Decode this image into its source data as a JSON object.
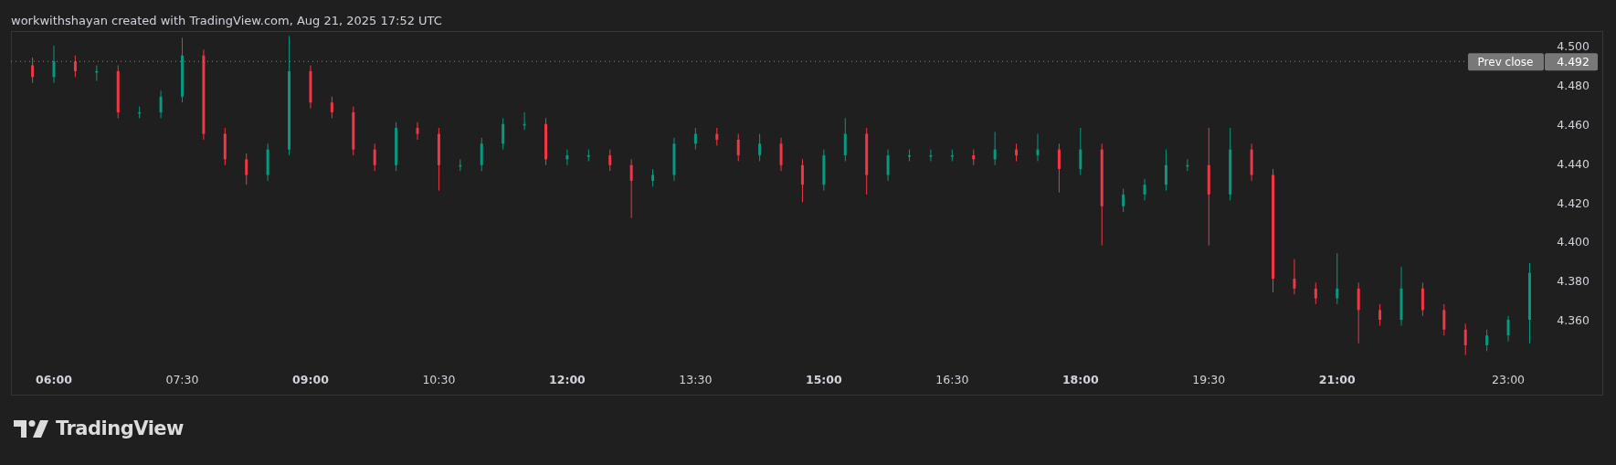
{
  "header": {
    "text": "workwithshayan created with TradingView.com, Aug 21, 2025 17:52 UTC"
  },
  "chart": {
    "chart_data": {
      "type": "candlestick",
      "x": [
        5.75,
        6,
        6.25,
        6.5,
        6.75,
        7,
        7.25,
        7.5,
        7.75,
        8,
        8.25,
        8.5,
        8.75,
        9,
        9.25,
        9.5,
        9.75,
        10,
        10.25,
        10.5,
        10.75,
        11,
        11.25,
        11.5,
        11.75,
        12,
        12.25,
        12.5,
        12.75,
        13,
        13.25,
        13.5,
        13.75,
        14,
        14.25,
        14.5,
        14.75,
        15,
        15.25,
        15.5,
        15.75,
        16,
        16.25,
        16.5,
        16.75,
        17,
        17.25,
        17.5,
        17.75,
        18,
        18.25,
        18.5,
        18.75,
        19,
        19.25,
        19.5,
        19.75,
        20,
        20.25,
        20.5,
        20.75,
        21,
        21.25,
        21.5,
        21.75,
        22,
        22.25,
        22.5,
        22.75,
        23,
        23.25
      ],
      "ohlc": [
        [
          4.49,
          4.494,
          4.481,
          4.484
        ],
        [
          4.484,
          4.5,
          4.481,
          4.492
        ],
        [
          4.492,
          4.495,
          4.484,
          4.487
        ],
        [
          4.487,
          4.49,
          4.482,
          4.487
        ],
        [
          4.487,
          4.49,
          4.463,
          4.466
        ],
        [
          4.466,
          4.469,
          4.463,
          4.466
        ],
        [
          4.466,
          4.477,
          4.463,
          4.474
        ],
        [
          4.474,
          4.504,
          4.471,
          4.495
        ],
        [
          4.495,
          4.498,
          4.452,
          4.455
        ],
        [
          4.455,
          4.458,
          4.439,
          4.442
        ],
        [
          4.442,
          4.445,
          4.429,
          4.434
        ],
        [
          4.434,
          4.45,
          4.431,
          4.447
        ],
        [
          4.447,
          4.505,
          4.444,
          4.487
        ],
        [
          4.487,
          4.49,
          4.468,
          4.471
        ],
        [
          4.471,
          4.474,
          4.463,
          4.466
        ],
        [
          4.466,
          4.469,
          4.444,
          4.447
        ],
        [
          4.447,
          4.45,
          4.436,
          4.439
        ],
        [
          4.439,
          4.461,
          4.436,
          4.458
        ],
        [
          4.458,
          4.461,
          4.452,
          4.455
        ],
        [
          4.455,
          4.458,
          4.426,
          4.439
        ],
        [
          4.439,
          4.442,
          4.436,
          4.439
        ],
        [
          4.439,
          4.453,
          4.436,
          4.45
        ],
        [
          4.45,
          4.463,
          4.447,
          4.46
        ],
        [
          4.46,
          4.466,
          4.457,
          4.46
        ],
        [
          4.46,
          4.463,
          4.439,
          4.442
        ],
        [
          4.442,
          4.447,
          4.439,
          4.444
        ],
        [
          4.444,
          4.447,
          4.441,
          4.444
        ],
        [
          4.444,
          4.447,
          4.436,
          4.439
        ],
        [
          4.439,
          4.442,
          4.412,
          4.431
        ],
        [
          4.431,
          4.437,
          4.428,
          4.434
        ],
        [
          4.434,
          4.453,
          4.431,
          4.45
        ],
        [
          4.45,
          4.458,
          4.447,
          4.455
        ],
        [
          4.455,
          4.458,
          4.449,
          4.452
        ],
        [
          4.452,
          4.455,
          4.441,
          4.444
        ],
        [
          4.444,
          4.455,
          4.441,
          4.45
        ],
        [
          4.45,
          4.453,
          4.436,
          4.439
        ],
        [
          4.439,
          4.442,
          4.42,
          4.429
        ],
        [
          4.429,
          4.447,
          4.426,
          4.444
        ],
        [
          4.444,
          4.463,
          4.441,
          4.455
        ],
        [
          4.455,
          4.458,
          4.424,
          4.434
        ],
        [
          4.434,
          4.447,
          4.431,
          4.444
        ],
        [
          4.444,
          4.447,
          4.441,
          4.444
        ],
        [
          4.444,
          4.447,
          4.441,
          4.444
        ],
        [
          4.444,
          4.447,
          4.441,
          4.444
        ],
        [
          4.444,
          4.447,
          4.439,
          4.442
        ],
        [
          4.442,
          4.456,
          4.439,
          4.447
        ],
        [
          4.447,
          4.45,
          4.441,
          4.444
        ],
        [
          4.444,
          4.455,
          4.441,
          4.447
        ],
        [
          4.447,
          4.45,
          4.425,
          4.437
        ],
        [
          4.437,
          4.458,
          4.434,
          4.447
        ],
        [
          4.447,
          4.45,
          4.398,
          4.418
        ],
        [
          4.418,
          4.427,
          4.415,
          4.424
        ],
        [
          4.424,
          4.432,
          4.421,
          4.429
        ],
        [
          4.429,
          4.447,
          4.426,
          4.439
        ],
        [
          4.439,
          4.442,
          4.436,
          4.439
        ],
        [
          4.439,
          4.458,
          4.398,
          4.424
        ],
        [
          4.424,
          4.458,
          4.421,
          4.447
        ],
        [
          4.447,
          4.45,
          4.431,
          4.434
        ],
        [
          4.434,
          4.437,
          4.374,
          4.381
        ],
        [
          4.381,
          4.391,
          4.373,
          4.376
        ],
        [
          4.376,
          4.379,
          4.368,
          4.371
        ],
        [
          4.371,
          4.394,
          4.368,
          4.376
        ],
        [
          4.376,
          4.379,
          4.348,
          4.365
        ],
        [
          4.365,
          4.368,
          4.357,
          4.36
        ],
        [
          4.36,
          4.387,
          4.357,
          4.376
        ],
        [
          4.376,
          4.379,
          4.362,
          4.365
        ],
        [
          4.365,
          4.368,
          4.352,
          4.355
        ],
        [
          4.355,
          4.358,
          4.342,
          4.347
        ],
        [
          4.347,
          4.355,
          4.344,
          4.352
        ],
        [
          4.352,
          4.362,
          4.349,
          4.36
        ],
        [
          4.36,
          4.389,
          4.348,
          4.384
        ]
      ],
      "xticks": [
        {
          "value": 6,
          "label": "06:00"
        },
        {
          "value": 7.5,
          "label": "07:30"
        },
        {
          "value": 9,
          "label": "09:00"
        },
        {
          "value": 10.5,
          "label": "10:30"
        },
        {
          "value": 12,
          "label": "12:00"
        },
        {
          "value": 13.5,
          "label": "13:30"
        },
        {
          "value": 15,
          "label": "15:00"
        },
        {
          "value": 16.5,
          "label": "16:30"
        },
        {
          "value": 18,
          "label": "18:00"
        },
        {
          "value": 19.5,
          "label": "19:30"
        },
        {
          "value": 21,
          "label": "21:00"
        },
        {
          "value": 23,
          "label": "23:00"
        }
      ],
      "yticks": [
        {
          "value": 4.5,
          "label": "4.500"
        },
        {
          "value": 4.48,
          "label": "4.480"
        },
        {
          "value": 4.46,
          "label": "4.460"
        },
        {
          "value": 4.44,
          "label": "4.440"
        },
        {
          "value": 4.42,
          "label": "4.420"
        },
        {
          "value": 4.4,
          "label": "4.400"
        },
        {
          "value": 4.38,
          "label": "4.380"
        },
        {
          "value": 4.36,
          "label": "4.360"
        }
      ],
      "xlim": [
        5.498,
        24.11
      ],
      "ylim": [
        4.3213,
        4.5075
      ],
      "ref_lines": [
        {
          "axis": "y",
          "value": 4.492
        }
      ]
    },
    "prev_close": {
      "label": "Prev close",
      "value": "4.492"
    }
  },
  "footer": {
    "logo_text": "TradingView"
  }
}
